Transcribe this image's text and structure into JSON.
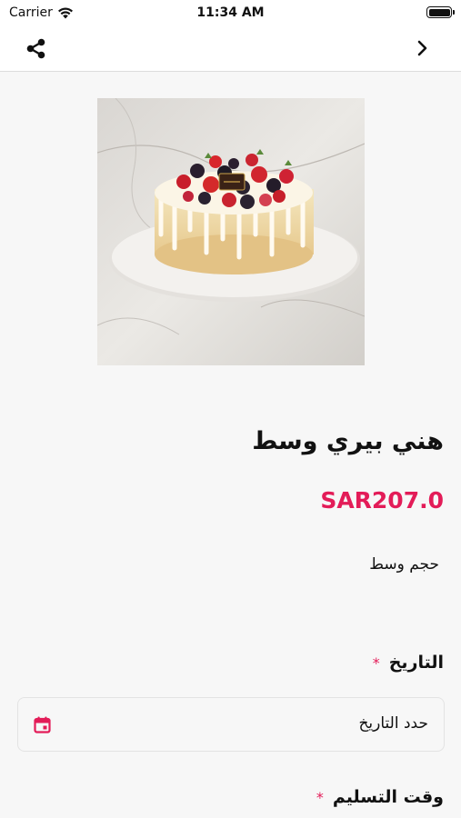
{
  "status_bar": {
    "carrier": "Carrier",
    "time": "11:34 AM"
  },
  "product": {
    "title": "هني بيري وسط",
    "price": "SAR207.0",
    "description": "حجم وسط"
  },
  "form": {
    "date_label": "التاريخ",
    "date_required_mark": "*",
    "date_placeholder": "حدد التاريخ",
    "delivery_time_label": "وقت التسليم",
    "delivery_time_required_mark": "*"
  },
  "colors": {
    "accent": "#e31c58",
    "background": "#f7f7f7"
  },
  "icons": {
    "share": "share-icon",
    "back": "chevron-right-icon",
    "calendar": "calendar-icon"
  }
}
